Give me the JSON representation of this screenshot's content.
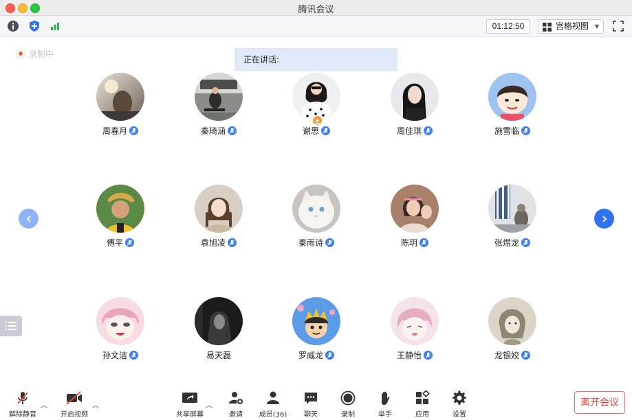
{
  "window": {
    "title": "腾讯会议"
  },
  "toolbar": {
    "timer": "01:12:50",
    "view_label": "宫格视图",
    "icons": [
      "info-icon",
      "shield-icon",
      "signal-icon",
      "fullscreen-icon"
    ]
  },
  "status": {
    "recording": "录制中",
    "speaking": "正在讲话:"
  },
  "participants": [
    {
      "name": "周春月",
      "muted_icon": "mic-icon"
    },
    {
      "name": "秦琦涵",
      "muted_icon": "mic-icon"
    },
    {
      "name": "谢思",
      "muted_icon": "mic-icon",
      "host": true
    },
    {
      "name": "周佳琪",
      "muted_icon": "mic-icon"
    },
    {
      "name": "施雪临",
      "muted_icon": "mic-icon"
    },
    {
      "name": "傅平",
      "muted_icon": "mic-icon"
    },
    {
      "name": "袁旭凌",
      "muted_icon": "mic-icon"
    },
    {
      "name": "秦雨诗",
      "muted_icon": "mic-icon"
    },
    {
      "name": "陈玥",
      "muted_icon": "mic-icon"
    },
    {
      "name": "张煜龙",
      "muted_icon": "mic-icon"
    },
    {
      "name": "孙文洁",
      "muted_icon": "mic-icon"
    },
    {
      "name": "易天磊",
      "muted_icon": "none"
    },
    {
      "name": "罗威龙",
      "muted_icon": "mic-icon"
    },
    {
      "name": "王静怡",
      "muted_icon": "mic-icon"
    },
    {
      "name": "龙银姣",
      "muted_icon": "mic-icon"
    }
  ],
  "bottombar": {
    "unmute": "解除静音",
    "start_video": "开启视频",
    "share_screen": "共享屏幕",
    "invite": "邀请",
    "members": "成员(36)",
    "chat": "聊天",
    "record": "录制",
    "raise_hand": "举手",
    "apps": "应用",
    "settings": "设置",
    "leave": "离开会议"
  },
  "colors": {
    "accent": "#2f74ee",
    "speaking_bg": "#dfe9f8",
    "leave": "#e8453c"
  }
}
